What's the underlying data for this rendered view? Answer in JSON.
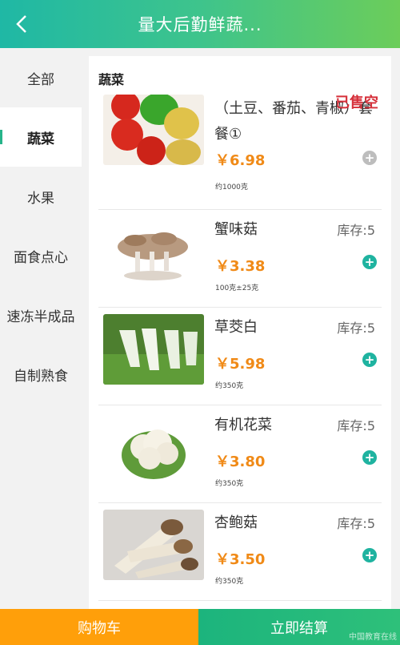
{
  "header": {
    "title": "量大后勤鲜蔬..."
  },
  "sidebar": {
    "items": [
      {
        "label": "全部"
      },
      {
        "label": "蔬菜"
      },
      {
        "label": "水果"
      },
      {
        "label": "面食点心"
      },
      {
        "label": "速冻半成品"
      },
      {
        "label": "自制熟食"
      }
    ]
  },
  "section": {
    "title": "蔬菜"
  },
  "products": [
    {
      "name": "（土豆、番茄、青椒）套餐①",
      "price": "￥6.98",
      "weight": "约1000克",
      "status": "已售空"
    },
    {
      "name": "蟹味菇",
      "price": "￥3.38",
      "weight": "100克±25克",
      "status": "库存:5"
    },
    {
      "name": "草茭白",
      "price": "￥5.98",
      "weight": "约350克",
      "status": "库存:5"
    },
    {
      "name": "有机花菜",
      "price": "￥3.80",
      "weight": "约350克",
      "status": "库存:5"
    },
    {
      "name": "杏鲍菇",
      "price": "￥3.50",
      "weight": "约350克",
      "status": "库存:5"
    }
  ],
  "bottom": {
    "cart_label": "购物车",
    "checkout_label": "立即结算",
    "watermark": "中国教育在线"
  },
  "colors": {
    "accent": "#1fb3a0",
    "price": "#f08a17",
    "soldout": "#d6303a",
    "cart": "#ff9f0a"
  }
}
